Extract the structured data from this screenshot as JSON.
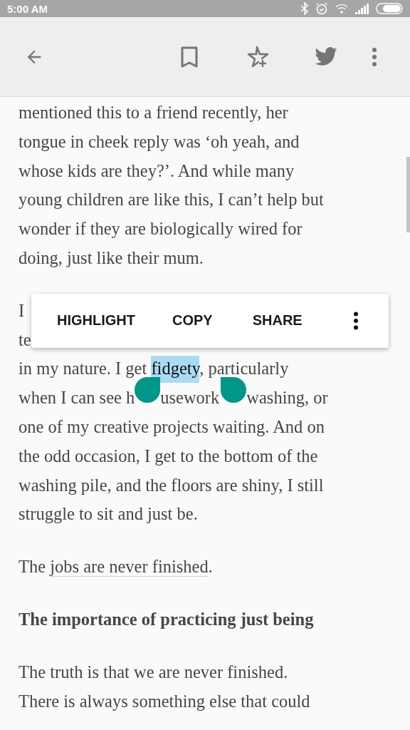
{
  "status_bar": {
    "time": "5:00 AM"
  },
  "article": [
    {
      "kind": "paragraph",
      "lines": [
        [
          {
            "text": "mentioned this to a friend recently, her"
          }
        ],
        [
          {
            "text": "tongue in cheek reply was ‘oh yeah, and"
          }
        ],
        [
          {
            "text": "whose kids are they?’. And while many"
          }
        ],
        [
          {
            "text": "young children are like this, I can’t help but"
          }
        ],
        [
          {
            "text": "wonder if they are biologically wired for"
          }
        ],
        [
          {
            "text": "doing, just like their mum."
          }
        ]
      ]
    },
    {
      "kind": "paragraph",
      "popup": true,
      "lines": [
        [
          {
            "text": "I"
          }
        ],
        [
          {
            "text": "te"
          }
        ],
        [
          {
            "text": "in my nature. I get "
          },
          {
            "text": "fidgety",
            "selected": true
          },
          {
            "text": ", particularly"
          }
        ],
        [
          {
            "text": "when I can see h"
          },
          {
            "kind": "handle"
          },
          {
            "text": "usework"
          },
          {
            "kind": "handle"
          },
          {
            "text": "washing, or"
          }
        ],
        [
          {
            "text": "one of my creative projects waiting. And on"
          }
        ],
        [
          {
            "text": "the odd occasion, I get to the bottom of the"
          }
        ],
        [
          {
            "text": "washing pile, and the floors are shiny, I still"
          }
        ],
        [
          {
            "text": "struggle to sit and just be."
          }
        ]
      ]
    },
    {
      "kind": "paragraph",
      "lines": [
        [
          {
            "text": "The "
          },
          {
            "text": "jobs are never finished",
            "link": true
          },
          {
            "text": "."
          }
        ]
      ]
    },
    {
      "kind": "heading",
      "lines": [
        [
          {
            "text": "The importance of practicing just being"
          }
        ]
      ]
    },
    {
      "kind": "paragraph",
      "lines": [
        [
          {
            "text": "The truth is that we are never finished."
          }
        ],
        [
          {
            "text": "There is always something else that could"
          }
        ]
      ]
    }
  ],
  "selection_menu": {
    "items": [
      "HIGHLIGHT",
      "COPY",
      "SHARE"
    ]
  }
}
